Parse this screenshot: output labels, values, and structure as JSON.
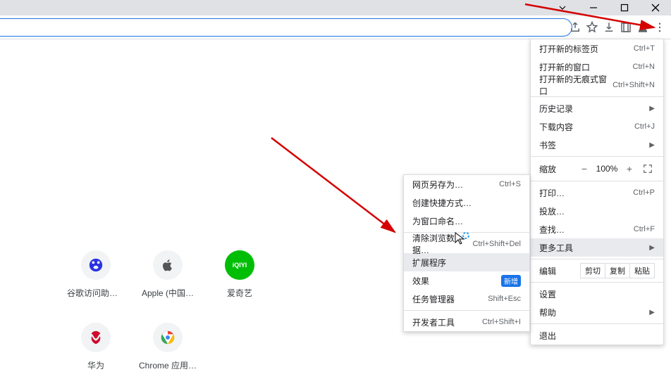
{
  "menu": {
    "main": [
      {
        "label": "打开新的标签页",
        "shortcut": "Ctrl+T"
      },
      {
        "label": "打开新的窗口",
        "shortcut": "Ctrl+N"
      },
      {
        "label": "打开新的无痕式窗口",
        "shortcut": "Ctrl+Shift+N"
      }
    ],
    "main2": [
      {
        "label": "历史记录",
        "submenu": true
      },
      {
        "label": "下载内容",
        "shortcut": "Ctrl+J"
      },
      {
        "label": "书签",
        "submenu": true
      }
    ],
    "zoom": {
      "label": "缩放",
      "minus": "−",
      "value": "100%",
      "plus": "+"
    },
    "main3": [
      {
        "label": "打印…",
        "shortcut": "Ctrl+P"
      },
      {
        "label": "投放…"
      },
      {
        "label": "查找…",
        "shortcut": "Ctrl+F"
      },
      {
        "label": "更多工具",
        "submenu": true,
        "active": true
      }
    ],
    "edit": {
      "label": "编辑",
      "cut": "剪切",
      "copy": "复制",
      "paste": "粘贴"
    },
    "main4": [
      {
        "label": "设置"
      },
      {
        "label": "帮助",
        "submenu": true
      }
    ],
    "main5": [
      {
        "label": "退出"
      }
    ],
    "sub": [
      {
        "label": "网页另存为…",
        "shortcut": "Ctrl+S"
      },
      {
        "label": "创建快捷方式…"
      },
      {
        "label": "为窗口命名…"
      }
    ],
    "sub2": [
      {
        "label": "清除浏览数据…",
        "shortcut": "Ctrl+Shift+Del"
      },
      {
        "label": "扩展程序",
        "hovered": true
      },
      {
        "label": "效果",
        "badge": "新增"
      },
      {
        "label": "任务管理器",
        "shortcut": "Shift+Esc"
      }
    ],
    "sub3": [
      {
        "label": "开发者工具",
        "shortcut": "Ctrl+Shift+I"
      }
    ]
  },
  "shortcuts": {
    "row1": [
      {
        "label": "谷歌访问助手…",
        "icon": "baidu",
        "color": "#2932e1"
      },
      {
        "label": "Apple (中国…",
        "icon": "apple",
        "color": "#555"
      },
      {
        "label": "爱奇艺",
        "icon": "iqiyi",
        "text": "iQIYI"
      }
    ],
    "row2": [
      {
        "label": "华为",
        "icon": "huawei",
        "color": "#cf0a2c"
      },
      {
        "label": "Chrome 应用…",
        "icon": "chrome"
      }
    ]
  }
}
